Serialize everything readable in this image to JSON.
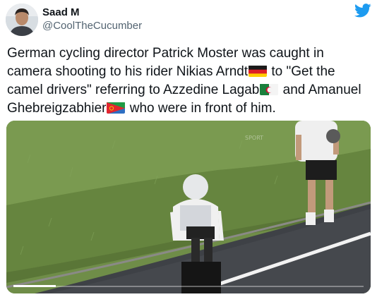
{
  "author": {
    "name": "Saad M",
    "handle": "@CoolTheCucumber"
  },
  "icons": {
    "avatar": "avatar-photo",
    "platform": "twitter-bird-icon",
    "flag_germany": "germany-flag",
    "flag_algeria": "algeria-flag",
    "flag_eritrea": "eritrea-flag"
  },
  "colors": {
    "twitter_blue": "#1d9bf0",
    "handle_gray": "#536471",
    "text": "#0f1419"
  },
  "tweet": {
    "part1": "German cycling director Patrick Moster was caught in camera shooting to his rider Nikias Arndt",
    "part2": " to \"Get the camel drivers\" referring to Azzedine Lagab",
    "part3": " and Amanuel Ghebreigzabhier",
    "part4": " who were in front of him."
  },
  "media": {
    "type": "video",
    "progress": 0.12
  }
}
